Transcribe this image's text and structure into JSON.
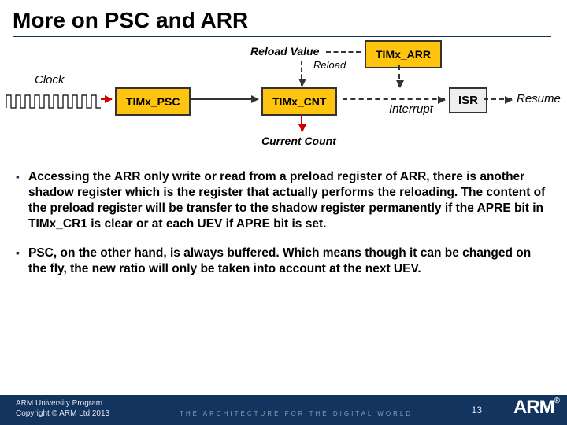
{
  "title": "More on PSC and ARR",
  "dia": {
    "clock": "Clock",
    "reload_value": "Reload Value",
    "reload": "Reload",
    "timx_arr": "TIMx_ARR",
    "timx_psc": "TIMx_PSC",
    "timx_cnt": "TIMx_CNT",
    "interrupt": "Interrupt",
    "isr": "ISR",
    "resume": "Resume",
    "current_count": "Current Count"
  },
  "bullets": [
    "Accessing the ARR only write or read from a preload register of ARR, there is another shadow register which is the register that actually performs the reloading. The content of the preload register will be transfer to the shadow register permanently if the APRE bit in TIMx_CR1 is clear or at each UEV if APRE bit is set.",
    "PSC, on the other hand, is always buffered. Which means though it can be changed on the fly, the new ratio will only be taken into account at the next UEV."
  ],
  "footer": {
    "line1": "ARM University Program",
    "line2": "Copyright © ARM Ltd 2013",
    "tagline": "THE ARCHITECTURE FOR THE DIGITAL WORLD",
    "page": "13",
    "logo": "ARM"
  }
}
